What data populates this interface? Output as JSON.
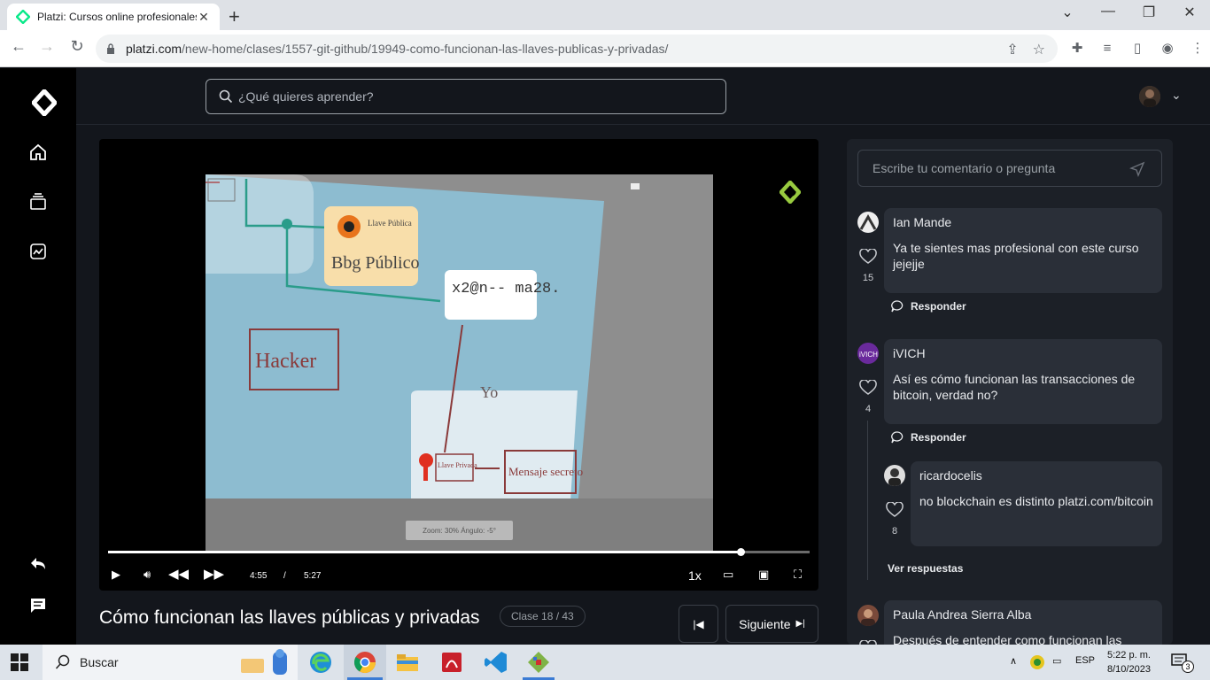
{
  "browser": {
    "tab_title": "Platzi: Cursos online profesionales",
    "url_host": "platzi.com",
    "url_path": "/new-home/clases/1557-git-github/19949-como-funcionan-las-llaves-publicas-y-privadas/"
  },
  "header": {
    "search_placeholder": "¿Qué quieres aprender?"
  },
  "video": {
    "current_time": "4:55",
    "separator": "/",
    "duration": "5:27",
    "progress_fraction": 0.902,
    "speed": "1x",
    "zoom_info": "Zoom: 30%  Ángulo: -5°",
    "slide_texts": {
      "public_key_label": "Llave Pública",
      "public_key_value": "Bbg Público",
      "encrypted": "x2@n-- ma28.",
      "hacker": "Hacker",
      "me": "Yo",
      "private_key_label": "Llave Privada",
      "secret_message": "Mensaje secreto"
    }
  },
  "lesson": {
    "title": "Cómo funcionan las llaves públicas y privadas",
    "badge": "Clase 18 / 43",
    "next_label": "Siguiente"
  },
  "comments": {
    "input_placeholder": "Escribe tu comentario o pregunta",
    "reply_label": "Responder",
    "see_replies_label": "Ver respuestas",
    "items": [
      {
        "author": "Ian Mande",
        "text": "Ya te sientes mas profesional con este curso jejejje",
        "likes": "15"
      },
      {
        "author": "iVICH",
        "text": "Así es cómo funcionan las transacciones de bitcoin, verdad no?",
        "likes": "4"
      },
      {
        "author": "ricardocelis",
        "text": "no blockchain es distinto platzi.com/bitcoin",
        "likes": "8"
      },
      {
        "author": "Paula Andrea Sierra Alba",
        "text": "Después de entender como funcionan las",
        "likes": ""
      }
    ]
  },
  "taskbar": {
    "search_label": "Buscar",
    "language": "ESP",
    "time": "5:22 p. m.",
    "date": "8/10/2023",
    "notifications": "3"
  },
  "colors": {
    "platzi_green": "#98ca3f",
    "background": "#13161c",
    "panel": "#1c2027"
  }
}
